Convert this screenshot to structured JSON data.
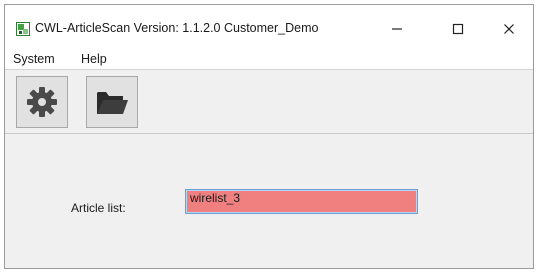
{
  "window": {
    "title": "CWL-ArticleScan  Version: 1.1.2.0  Customer_Demo",
    "min_glyph": "—",
    "max_glyph": "☐",
    "close_glyph": "✕"
  },
  "menu": {
    "system_label": "System",
    "help_label": "Help"
  },
  "toolbar": {
    "settings_icon": "gear-icon",
    "open_icon": "folder-icon"
  },
  "form": {
    "article_list_label": "Article list:",
    "article_list_value": "wirelist_3"
  },
  "colors": {
    "input_error_bg": "#f08080",
    "input_focus_border": "#6aa0d8",
    "panel_bg": "#f0f0f0",
    "gear_color": "#4a4a4a",
    "folder_color": "#333333"
  }
}
